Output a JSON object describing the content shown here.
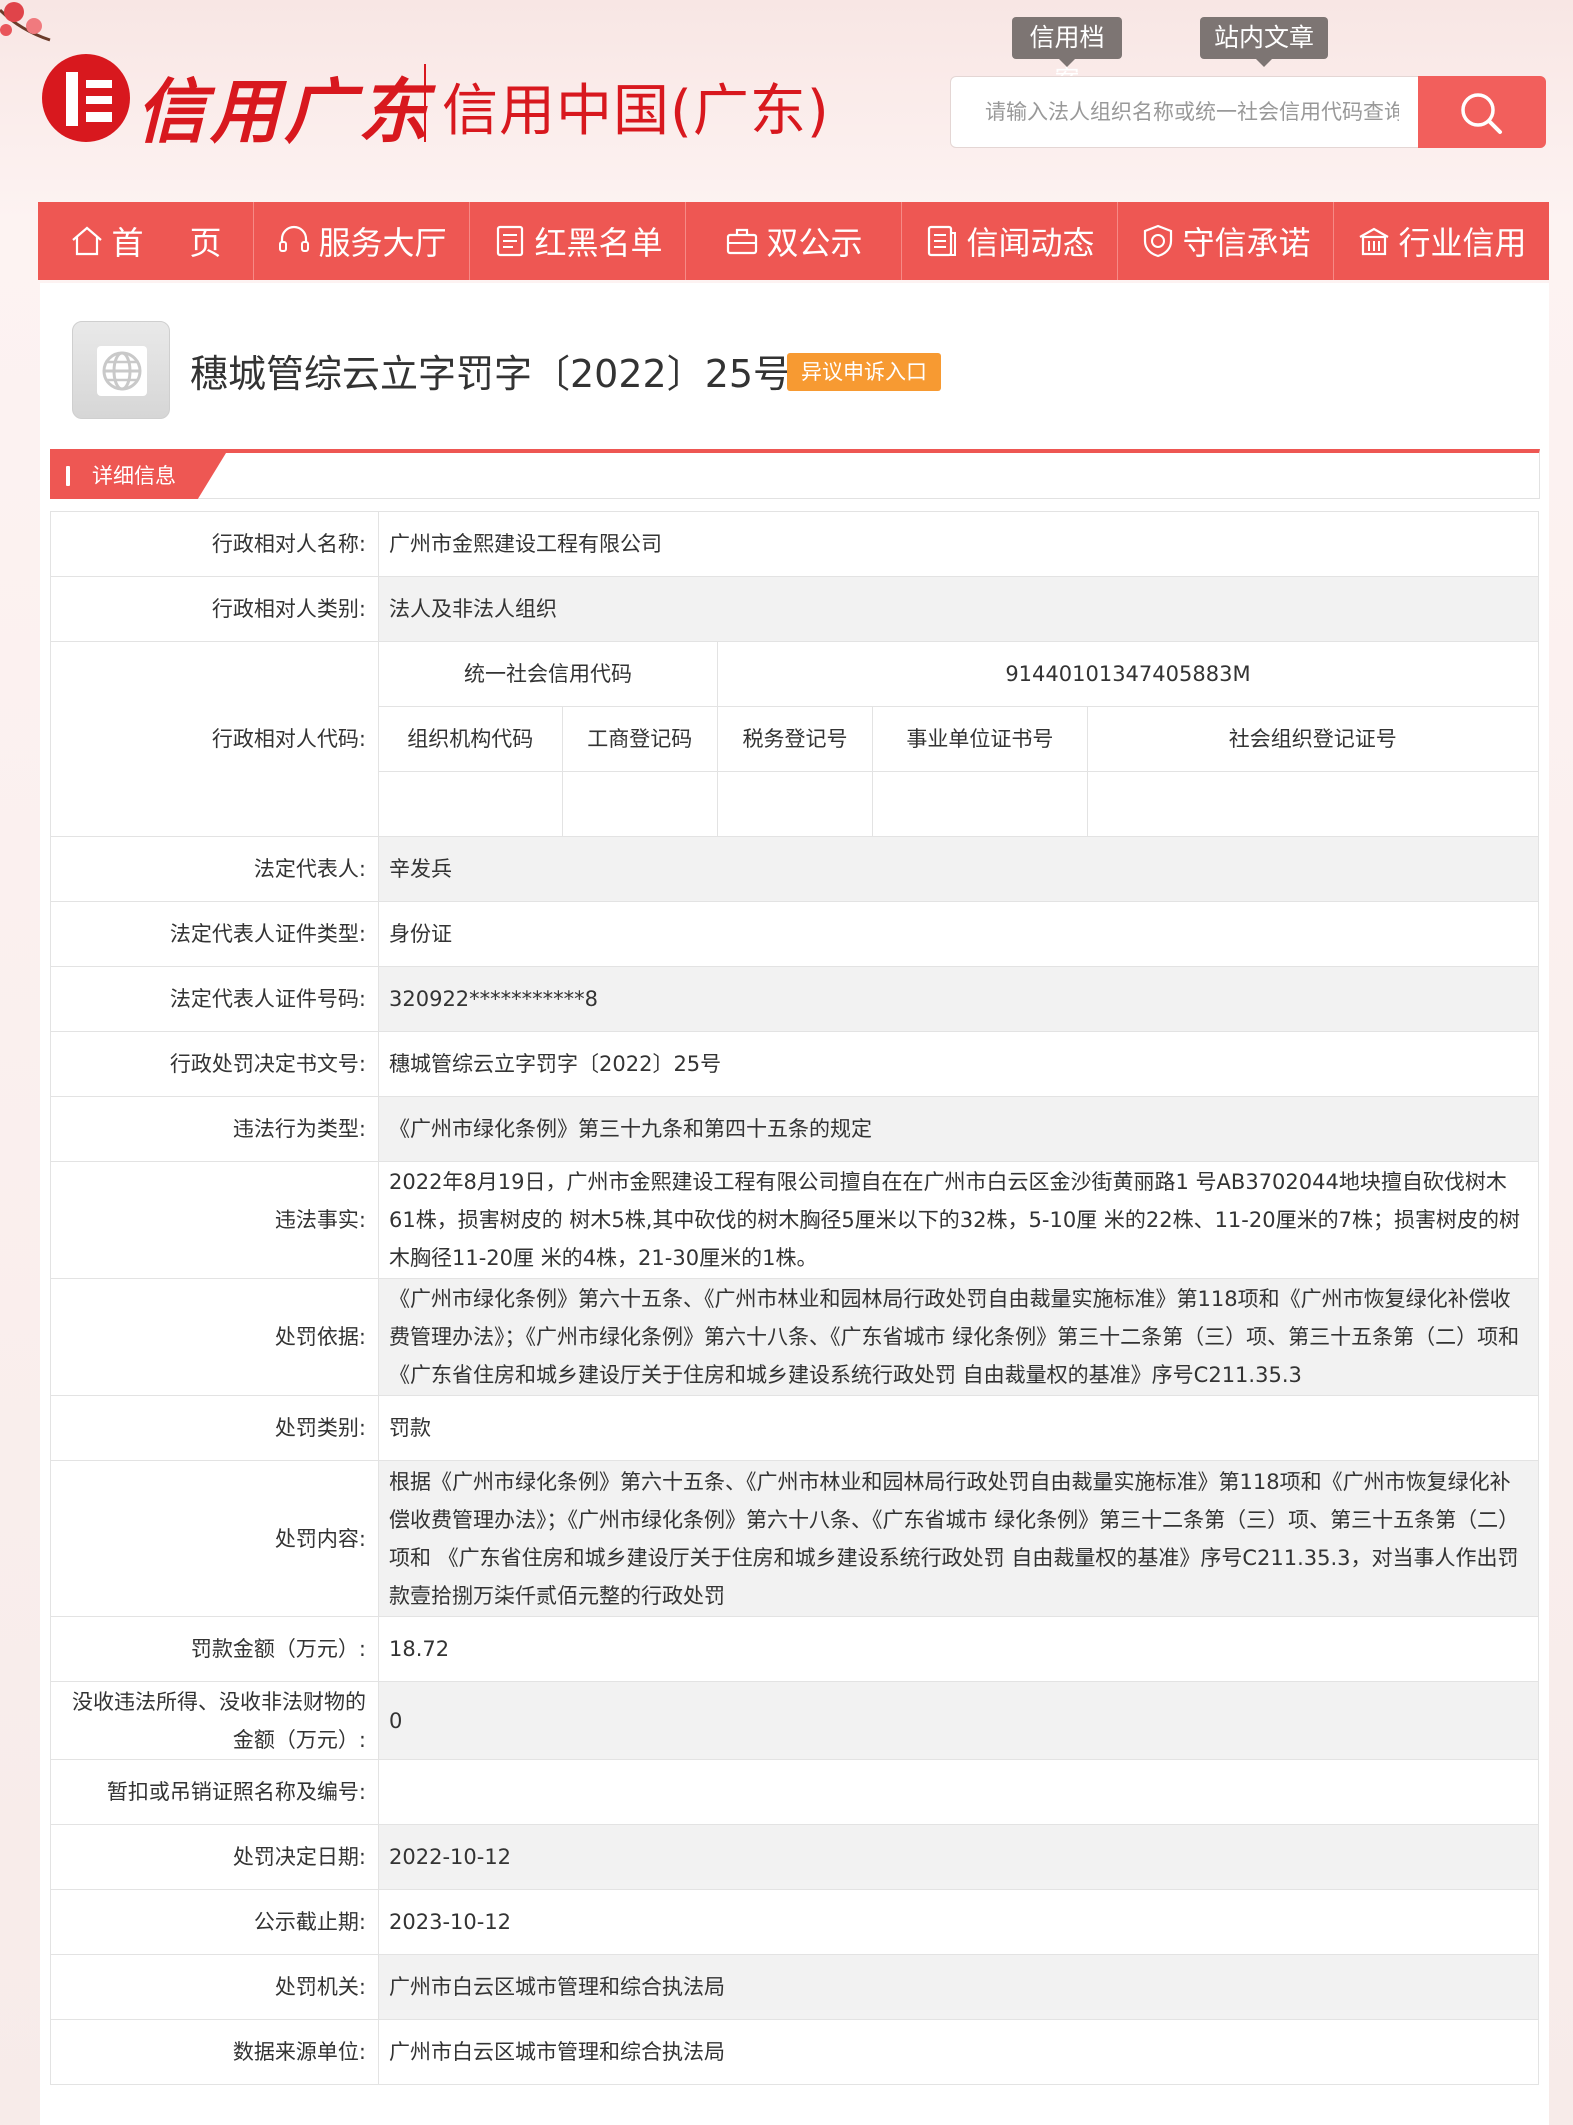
{
  "header": {
    "logo_script": "信用广东",
    "logo_sub": "信用中国(广东)",
    "top_tabs": [
      "信用档案",
      "站内文章"
    ],
    "search_placeholder": "请输入法人组织名称或统一社会信用代码查询"
  },
  "nav": {
    "items": [
      {
        "label": "首页",
        "icon": "home-icon"
      },
      {
        "label": "服务大厅",
        "icon": "headset-icon"
      },
      {
        "label": "红黑名单",
        "icon": "list-icon"
      },
      {
        "label": "双公示",
        "icon": "briefcase-icon"
      },
      {
        "label": "信闻动态",
        "icon": "news-icon"
      },
      {
        "label": "守信承诺",
        "icon": "shield-icon"
      },
      {
        "label": "行业信用",
        "icon": "building-icon"
      }
    ]
  },
  "record": {
    "title": "穗城管综云立字罚字〔2022〕25号",
    "appeal_label": "异议申诉入口",
    "section_label": "详细信息"
  },
  "details": {
    "party_name": {
      "label": "行政相对人名称:",
      "value": "广州市金熙建设工程有限公司"
    },
    "party_type": {
      "label": "行政相对人类别:",
      "value": "法人及非法人组织"
    },
    "party_code": {
      "label": "行政相对人代码:",
      "usc_label": "统一社会信用代码",
      "usc_value": "91440101347405883M",
      "sub_headers": [
        "组织机构代码",
        "工商登记码",
        "税务登记号",
        "事业单位证书号",
        "社会组织登记证号"
      ]
    },
    "legal_rep": {
      "label": "法定代表人:",
      "value": "辛发兵"
    },
    "id_type": {
      "label": "法定代表人证件类型:",
      "value": "身份证"
    },
    "id_number": {
      "label": "法定代表人证件号码:",
      "value": "320922***********8"
    },
    "decision_no": {
      "label": "行政处罚决定书文号:",
      "value": "穗城管综云立字罚字〔2022〕25号"
    },
    "violation_type": {
      "label": "违法行为类型:",
      "value": "《广州市绿化条例》第三十九条和第四十五条的规定"
    },
    "facts": {
      "label": "违法事实:",
      "value": "2022年8月19日，广州市金熙建设工程有限公司擅自在在广州市白云区金沙街黄丽路1 号AB3702044地块擅自砍伐树木61株，损害树皮的 树木5株,其中砍伐的树木胸径5厘米以下的32株，5-10厘 米的22株、11-20厘米的7株；损害树皮的树木胸径11-20厘 米的4株，21-30厘米的1株。"
    },
    "basis": {
      "label": "处罚依据:",
      "value": "《广州市绿化条例》第六十五条、《广州市林业和园林局行政处罚自由裁量实施标准》第118项和《广州市恢复绿化补偿收费管理办法》；《广州市绿化条例》第六十八条、《广东省城市 绿化条例》第三十二条第（三）项、第三十五条第（二）项和《广东省住房和城乡建设厅关于住房和城乡建设系统行政处罚 自由裁量权的基准》序号C211.35.3"
    },
    "penalty_type": {
      "label": "处罚类别:",
      "value": "罚款"
    },
    "penalty_content": {
      "label": "处罚内容:",
      "value": "根据《广州市绿化条例》第六十五条、《广州市林业和园林局行政处罚自由裁量实施标准》第118项和《广州市恢复绿化补偿收费管理办法》；《广州市绿化条例》第六十八条、《广东省城市 绿化条例》第三十二条第（三）项、第三十五条第（二）项和 《广东省住房和城乡建设厅关于住房和城乡建设系统行政处罚 自由裁量权的基准》序号C211.35.3，对当事人作出罚款壹拾捌万柒仟贰佰元整的行政处罚"
    },
    "fine_amount": {
      "label": "罚款金额（万元）:",
      "value": "18.72"
    },
    "confiscation": {
      "label": "没收违法所得、没收非法财物的金额（万元）:",
      "value": "0"
    },
    "license": {
      "label": "暂扣或吊销证照名称及编号:",
      "value": ""
    },
    "decision_date": {
      "label": "处罚决定日期:",
      "value": "2022-10-12"
    },
    "public_end": {
      "label": "公示截止期:",
      "value": "2023-10-12"
    },
    "authority": {
      "label": "处罚机关:",
      "value": "广州市白云区城市管理和综合执法局"
    },
    "data_source": {
      "label": "数据来源单位:",
      "value": "广州市白云区城市管理和综合执法局"
    }
  },
  "colors": {
    "brand_red": "#d8181e",
    "nav_bg": "#ee5753",
    "appeal_orange": "#f79a32",
    "tab_gray": "#7d7573"
  }
}
